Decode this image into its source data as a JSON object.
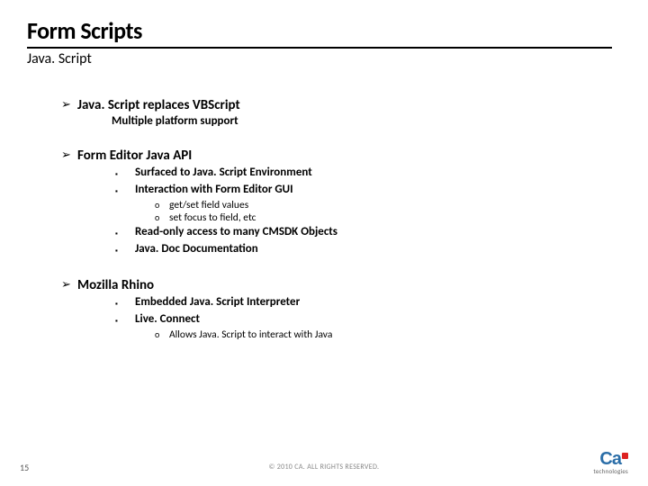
{
  "title": "Form Scripts",
  "subtitle": "Java. Script",
  "sections": [
    {
      "heading": "Java. Script replaces VBScript",
      "subheading": "Multiple platform support"
    },
    {
      "heading": "Form Editor Java API",
      "items_a": [
        "Surfaced to Java. Script Environment",
        "Interaction with Form Editor GUI"
      ],
      "subitems": [
        "get/set field values",
        "set focus to field, etc"
      ],
      "items_b": [
        "Read-only access to many CMSDK Objects",
        "Java. Doc Documentation"
      ]
    },
    {
      "heading": "Mozilla Rhino",
      "items_a": [
        "Embedded Java. Script Interpreter",
        "Live. Connect"
      ],
      "subitems": [
        "Allows Java. Script to interact with Java"
      ]
    }
  ],
  "footer": {
    "page": "15",
    "copyright": "© 2010 CA. ALL RIGHTS RESERVED.",
    "logo_main": "Ca",
    "logo_sub": "technologies"
  },
  "bullets": {
    "arrow": "➢",
    "square": "▪",
    "circle": "o"
  }
}
